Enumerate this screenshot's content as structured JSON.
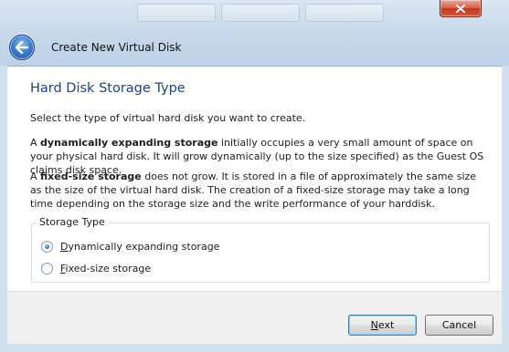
{
  "window": {
    "title": "Create New Virtual Disk",
    "close_label": "✕"
  },
  "page": {
    "heading": "Hard Disk Storage Type",
    "intro": "Select the type of virtual hard disk you want to create.",
    "dynamic_prefix": "A ",
    "dynamic_bold": "dynamically expanding storage",
    "dynamic_rest": " initially occupies a very small amount of space on your physical hard disk. It will grow dynamically (up to the size specified) as the Guest OS claims disk space.",
    "fixed_prefix": "A ",
    "fixed_bold": "fixed-size storage",
    "fixed_rest": " does not grow. It is stored in a file of approximately the same size as the size of the virtual hard disk. The creation of a fixed-size storage may take a long time depending on the storage size and the write performance of your harddisk."
  },
  "storage_type": {
    "label": "Storage Type",
    "options": [
      {
        "mnemonic": "D",
        "rest": "ynamically expanding storage",
        "selected": true
      },
      {
        "mnemonic": "F",
        "rest": "ixed-size storage",
        "selected": false
      }
    ]
  },
  "buttons": {
    "next_mnemonic": "N",
    "next_rest": "ext",
    "cancel": "Cancel"
  },
  "colors": {
    "heading": "#1e3f8e",
    "glass": "#c6d8ea",
    "close": "#c3361b"
  },
  "icons": {
    "back": "back-arrow-icon",
    "close": "close-icon"
  }
}
